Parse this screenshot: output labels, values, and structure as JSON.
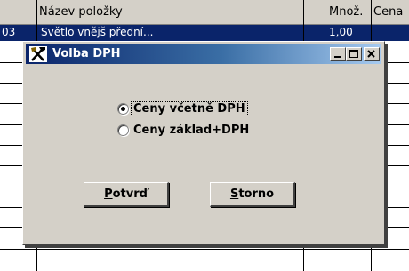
{
  "grid": {
    "columns": [
      "Název položky",
      "Množ.",
      "Cena"
    ],
    "selected_row": {
      "code": "03",
      "name": "Světlo vnějš přední...",
      "qty": "1,00"
    }
  },
  "dialog": {
    "title": "Volba DPH",
    "options": [
      {
        "label": "Ceny včetně DPH",
        "checked": true
      },
      {
        "label": "Ceny základ+DPH",
        "checked": false
      }
    ],
    "buttons": {
      "confirm": {
        "hotkey": "P",
        "rest": "otvrď"
      },
      "cancel": {
        "hotkey": "S",
        "rest": "torno"
      }
    }
  }
}
